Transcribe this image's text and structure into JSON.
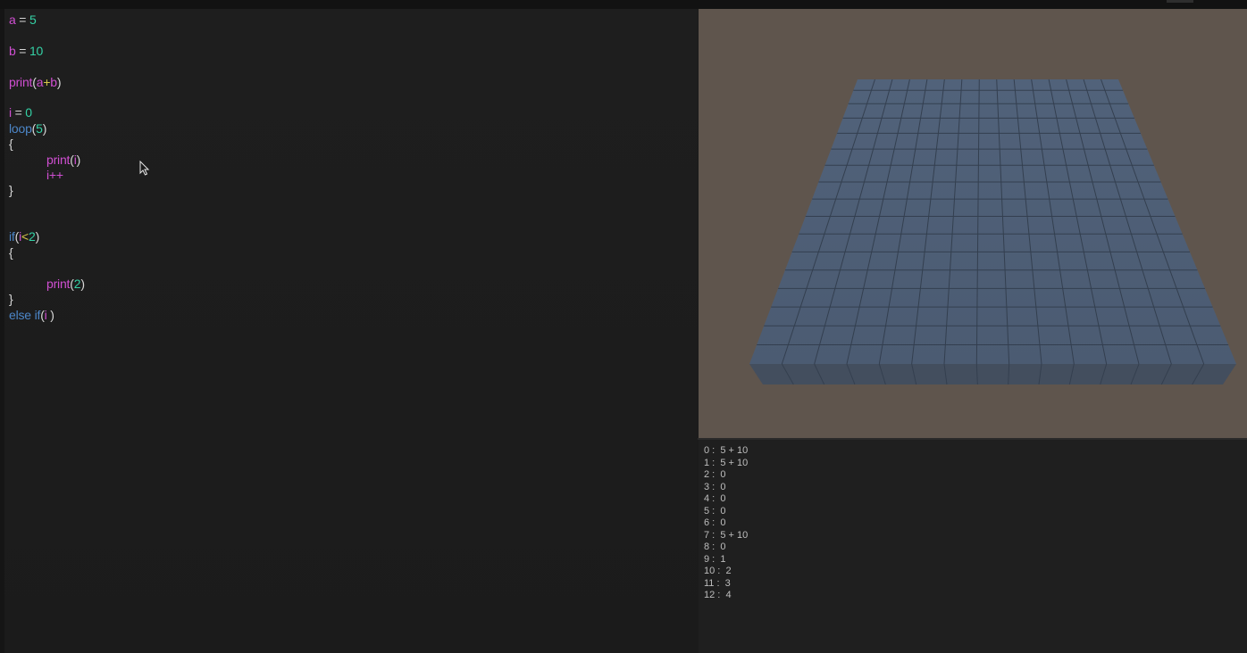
{
  "editor": {
    "lines": [
      {
        "id": "l1",
        "tokens": [
          {
            "t": "a",
            "c": "pink"
          },
          {
            "t": " = ",
            "c": "white"
          },
          {
            "t": "5",
            "c": "green"
          }
        ]
      },
      {
        "id": "l2",
        "tokens": [
          {
            "t": "b",
            "c": "pink"
          },
          {
            "t": " = ",
            "c": "white"
          },
          {
            "t": "10",
            "c": "green"
          }
        ]
      },
      {
        "id": "l3",
        "tokens": [
          {
            "t": "print",
            "c": "pink"
          },
          {
            "t": "(",
            "c": "white"
          },
          {
            "t": "a",
            "c": "pink"
          },
          {
            "t": "+",
            "c": "yellow"
          },
          {
            "t": "b",
            "c": "pink"
          },
          {
            "t": ")",
            "c": "white"
          }
        ]
      },
      {
        "id": "l4",
        "tokens": [
          {
            "t": "i",
            "c": "pink"
          },
          {
            "t": " = ",
            "c": "white"
          },
          {
            "t": "0",
            "c": "green"
          }
        ]
      },
      {
        "id": "l5",
        "tokens": [
          {
            "t": "loop",
            "c": "blue"
          },
          {
            "t": "(",
            "c": "white"
          },
          {
            "t": "5",
            "c": "green"
          },
          {
            "t": ")",
            "c": "white"
          }
        ]
      },
      {
        "id": "l6",
        "tokens": [
          {
            "t": "{",
            "c": "white"
          }
        ]
      },
      {
        "id": "l7",
        "tokens": [
          {
            "t": "print",
            "c": "pink"
          },
          {
            "t": "(",
            "c": "white"
          },
          {
            "t": "i",
            "c": "pink"
          },
          {
            "t": ")",
            "c": "white"
          }
        ]
      },
      {
        "id": "l8",
        "tokens": [
          {
            "t": "i++",
            "c": "pink"
          }
        ]
      },
      {
        "id": "l9",
        "tokens": [
          {
            "t": "}",
            "c": "white"
          }
        ]
      },
      {
        "id": "l10",
        "tokens": [
          {
            "t": "if",
            "c": "blue"
          },
          {
            "t": "(",
            "c": "white"
          },
          {
            "t": "i",
            "c": "pink"
          },
          {
            "t": "<",
            "c": "yellow"
          },
          {
            "t": "2",
            "c": "green"
          },
          {
            "t": ")",
            "c": "white"
          }
        ]
      },
      {
        "id": "l11",
        "tokens": [
          {
            "t": "{",
            "c": "white"
          }
        ]
      },
      {
        "id": "l12",
        "tokens": [
          {
            "t": "print",
            "c": "pink"
          },
          {
            "t": "(",
            "c": "white"
          },
          {
            "t": "2",
            "c": "green"
          },
          {
            "t": ")",
            "c": "white"
          }
        ]
      },
      {
        "id": "l13",
        "tokens": [
          {
            "t": "}",
            "c": "white"
          }
        ]
      },
      {
        "id": "l14",
        "tokens": [
          {
            "t": "else if",
            "c": "blue"
          },
          {
            "t": "(",
            "c": "white"
          },
          {
            "t": "i",
            "c": "pink"
          },
          {
            "t": " )",
            "c": "white"
          }
        ]
      }
    ]
  },
  "console": {
    "lines": [
      "0 :  5 + 10",
      "1 :  5 + 10",
      "2 :  0",
      "3 :  0",
      "4 :  0",
      "5 :  0",
      "6 :  0",
      "7 :  5 + 10",
      "8 :  0",
      "9 :  1",
      "10 :  2",
      "11 :  3",
      "12 :  4"
    ]
  },
  "colors": {
    "pink": "#d04fd2",
    "green": "#34d2a6",
    "white": "#d8d8d8",
    "yellow": "#d8c84a",
    "blue": "#4c86c8",
    "viewport_bg": "#5f554d",
    "grid_fill": "#4f6077"
  }
}
